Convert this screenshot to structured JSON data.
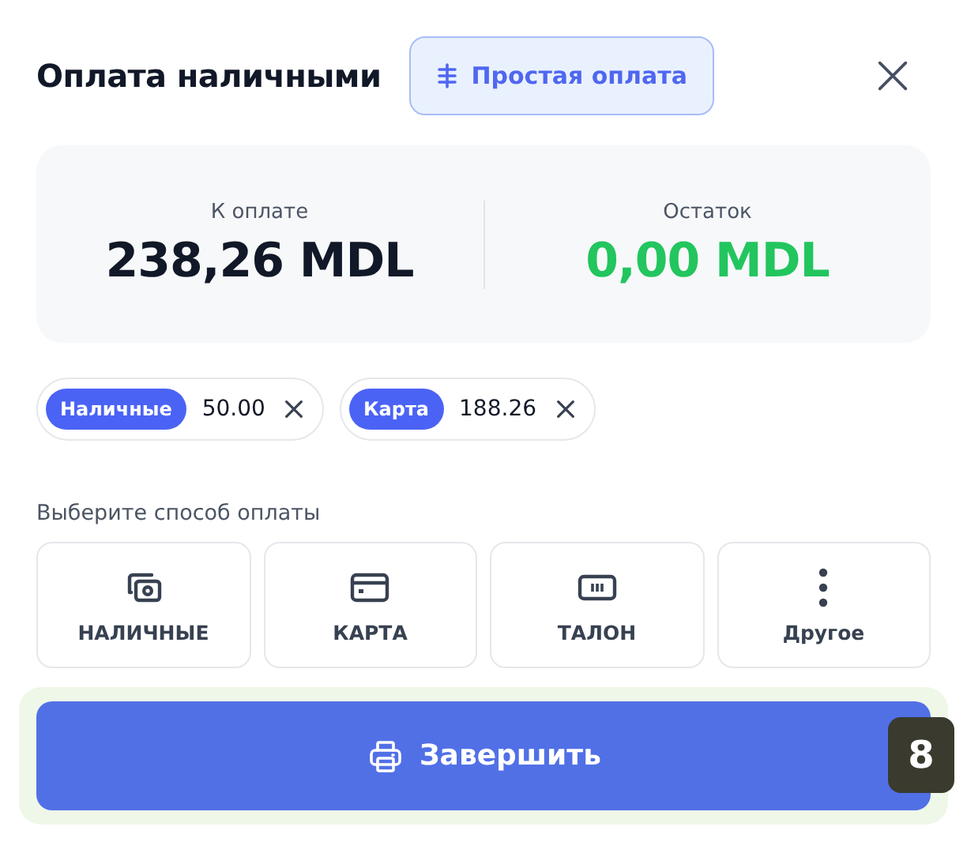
{
  "header": {
    "title": "Оплата наличными",
    "mode_button": "Простая оплата"
  },
  "summary": [
    {
      "label": "К оплате",
      "value": "238,26 MDL",
      "color": "#111827"
    },
    {
      "label": "Остаток",
      "value": "0,00 MDL",
      "color": "#22c55e"
    }
  ],
  "payments": [
    {
      "method": "Наличные",
      "amount": "50.00"
    },
    {
      "method": "Карта",
      "amount": "188.26"
    }
  ],
  "method_prompt": "Выберите способ оплаты",
  "methods": [
    {
      "kind": "cash",
      "label": "НАЛИЧНЫЕ"
    },
    {
      "kind": "card",
      "label": "КАРТА"
    },
    {
      "kind": "voucher",
      "label": "ТАЛОН"
    },
    {
      "kind": "more",
      "label": "Другое"
    }
  ],
  "finish_button": "Завершить",
  "shortcut_badge": "8"
}
